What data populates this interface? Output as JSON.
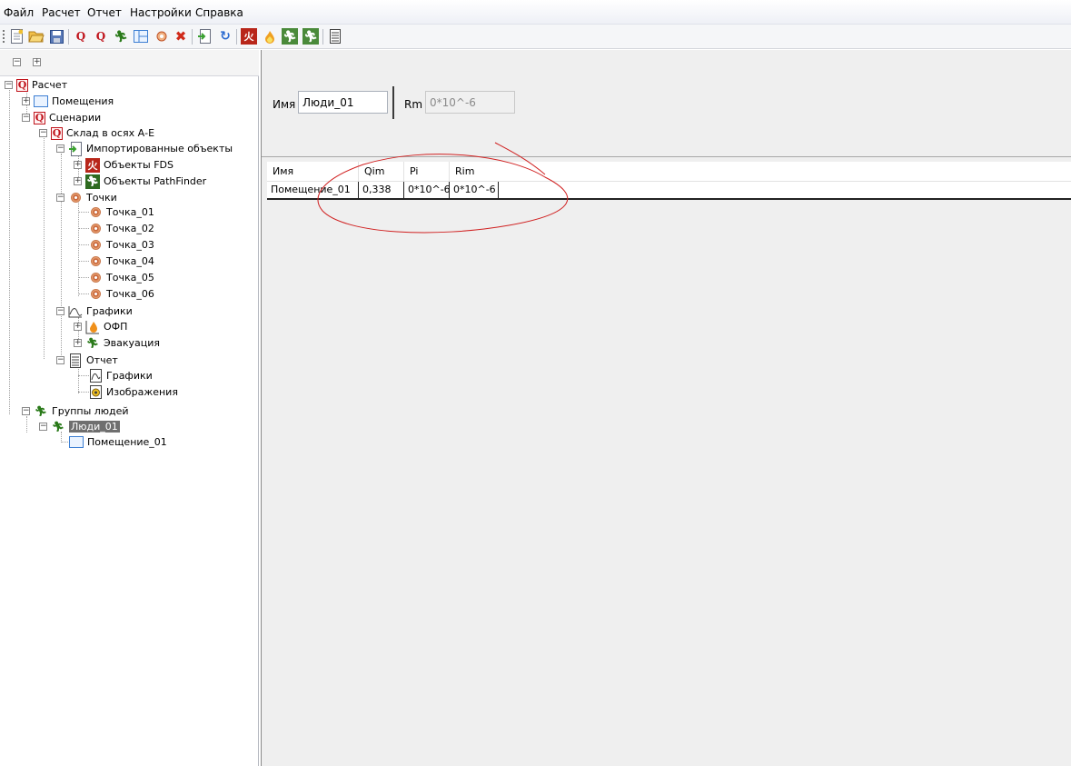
{
  "menu": {
    "items": [
      "Файл",
      "Расчет",
      "Отчет",
      "Настройки",
      "Справка"
    ]
  },
  "toolbar": {
    "icons": [
      "new-document-icon",
      "open-folder-icon",
      "save-icon",
      "calc-q-icon",
      "calc-q-alt-icon",
      "evacuation-run-icon",
      "room-icon",
      "point-icon",
      "delete-icon",
      "import-icon",
      "refresh-icon",
      "fds-icon",
      "fire-icon",
      "pathfinder-icon",
      "pathfinder-alt-icon",
      "report-icon"
    ]
  },
  "tree": {
    "root": "Расчет",
    "rooms": "Помещения",
    "scenarios": "Сценарии",
    "scenario_1": "Склад в осях А-Е",
    "imported": "Импортированные объекты",
    "fds_objects": "Объекты FDS",
    "pf_objects": "Объекты PathFinder",
    "points": "Точки",
    "point_items": [
      "Точка_01",
      "Точка_02",
      "Точка_03",
      "Точка_04",
      "Точка_05",
      "Точка_06"
    ],
    "charts": "Графики",
    "ofp": "ОФП",
    "evac": "Эвакуация",
    "report": "Отчет",
    "report_charts": "Графики",
    "report_images": "Изображения",
    "groups": "Группы людей",
    "group_1": "Люди_01",
    "group_room": "Помещение_01"
  },
  "props": {
    "name_label": "Имя",
    "name_value": "Люди_01",
    "rm_label": "Rm",
    "rm_value": "0*10^-6"
  },
  "table": {
    "headers": [
      "Имя",
      "Qim",
      "Pi",
      "Rim"
    ],
    "rows": [
      [
        "Помещение_01",
        "0,338",
        "0*10^-6",
        "0*10^-6"
      ]
    ]
  },
  "colors": {
    "annotation": "#d02020",
    "selection": "#6f6f6f"
  }
}
